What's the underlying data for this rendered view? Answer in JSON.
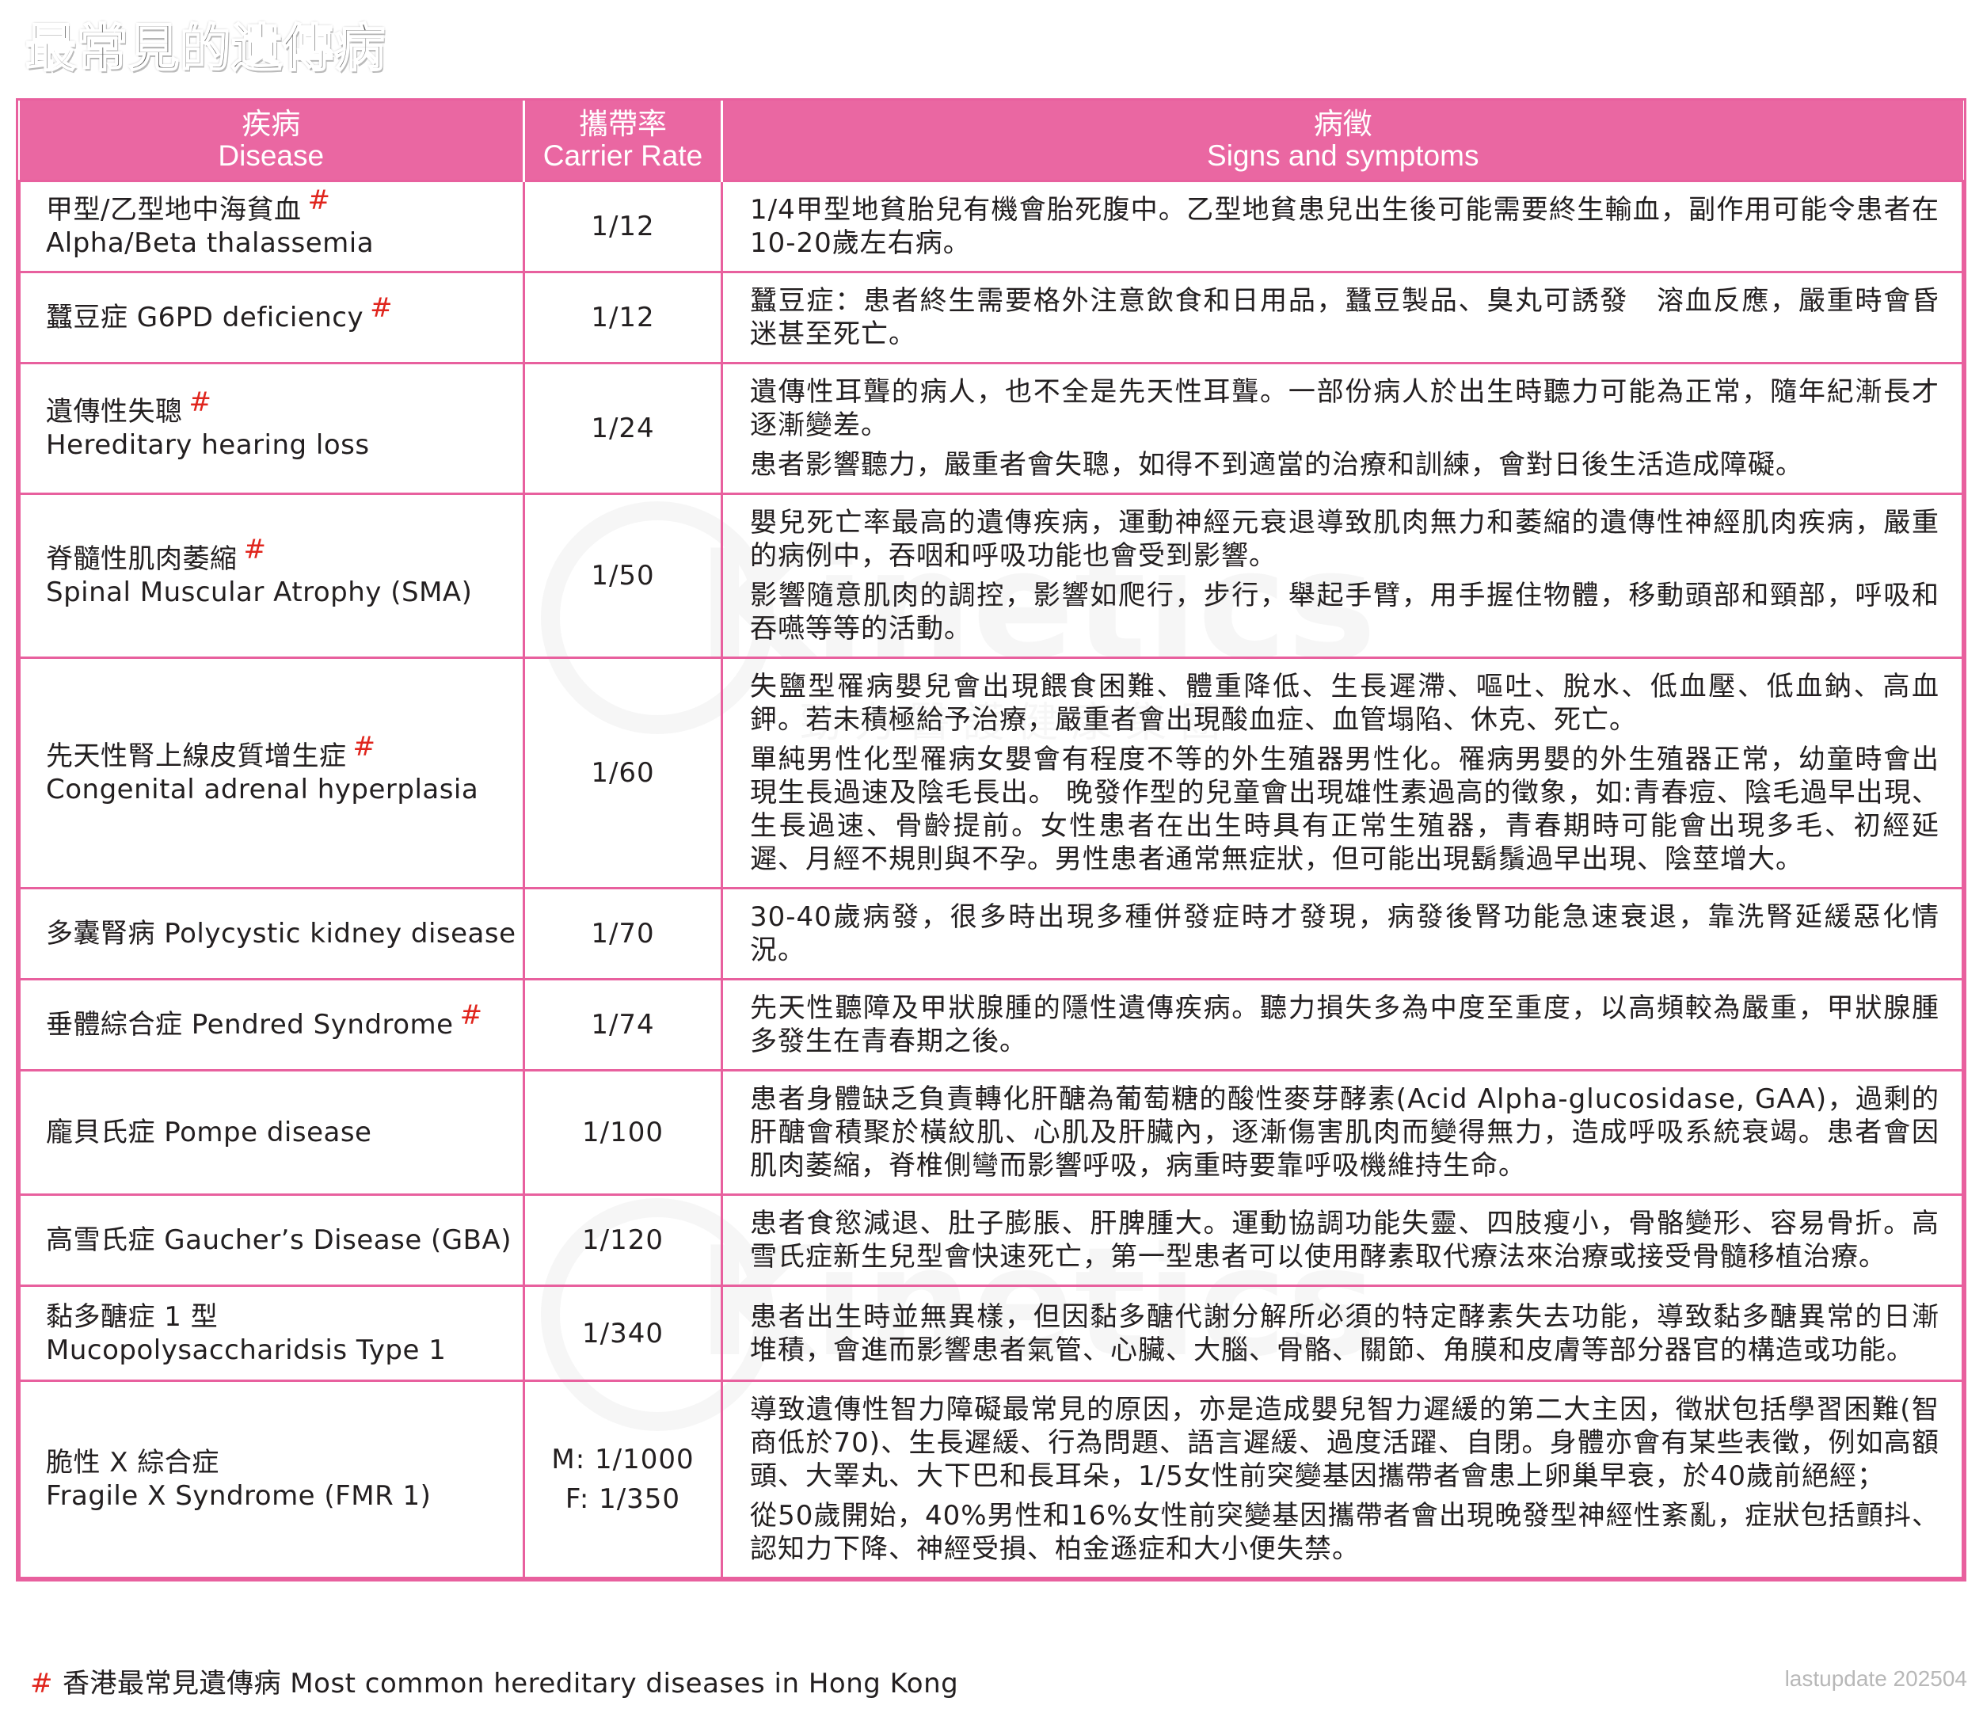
{
  "title": "最常見的遺傳病",
  "watermark": {
    "text": "Kinetics",
    "registered": "®",
    "subtext": "勁 力 醫 護 健 康 集 團",
    "color": "#c9c9c9"
  },
  "colors": {
    "header_bg": "#ea67a2",
    "border": "#e8609e",
    "hash": "#e0251d"
  },
  "header": {
    "disease_zh": "疾病",
    "disease_en": "Disease",
    "rate_zh": "攜帶率",
    "rate_en": "Carrier Rate",
    "symptoms_zh": "病徵",
    "symptoms_en": "Signs and symptoms"
  },
  "rows": [
    {
      "name_line1": "甲型/乙型地中海貧血",
      "name_line2": "Alpha/Beta thalassemia",
      "hk_mark": "#",
      "rate_line1": "1/12",
      "rate_line2": "",
      "symptoms": [
        "1/4甲型地貧胎兒有機會胎死腹中。乙型地貧患兒出生後可能需要終生輸血，副作用可能令患者在10-20歲左右病。"
      ]
    },
    {
      "name_line1": "蠶豆症 G6PD deficiency",
      "name_line2": "",
      "hk_mark": "#",
      "rate_line1": "1/12",
      "rate_line2": "",
      "symptoms": [
        "蠶豆症：患者終生需要格外注意飲食和日用品，蠶豆製品、臭丸可誘發　溶血反應，嚴重時會昏迷甚至死亡。"
      ]
    },
    {
      "name_line1": "遺傳性失聰",
      "name_line2": "Hereditary hearing loss",
      "hk_mark": "#",
      "rate_line1": "1/24",
      "rate_line2": "",
      "symptoms": [
        "遺傳性耳聾的病人，也不全是先天性耳聾。一部份病人於出生時聽力可能為正常，隨年紀漸長才逐漸變差。",
        "患者影響聽力，嚴重者會失聰，如得不到適當的治療和訓練，會對日後生活造成障礙。"
      ]
    },
    {
      "name_line1": "脊髓性肌肉萎縮",
      "name_line2": "Spinal Muscular Atrophy (SMA)",
      "hk_mark": "#",
      "rate_line1": "1/50",
      "rate_line2": "",
      "symptoms": [
        "嬰兒死亡率最高的遺傳疾病，運動神經元衰退導致肌肉無力和萎縮的遺傳性神經肌肉疾病，嚴重的病例中，吞咽和呼吸功能也會受到影響。",
        "影響隨意肌肉的調控，影響如爬行，步行，舉起手臂，用手握住物體，移動頭部和頸部，呼吸和吞嚥等等的活動。"
      ]
    },
    {
      "name_line1": "先天性腎上線皮質增生症",
      "name_line2": "Congenital adrenal hyperplasia",
      "hk_mark": "#",
      "rate_line1": "1/60",
      "rate_line2": "",
      "symptoms": [
        "失鹽型罹病嬰兒會出現餵食困難、體重降低、生長遲滯、嘔吐、脫水、低血壓、低血鈉、高血鉀。若未積極給予治療，嚴重者會出現酸血症、血管塌陷、休克、死亡。",
        "單純男性化型罹病女嬰會有程度不等的外生殖器男性化。罹病男嬰的外生殖器正常，幼童時會出現生長過速及陰毛長出。 晚發作型的兒童會出現雄性素過高的徵象，如:青春痘、陰毛過早出現、生長過速、骨齡提前。女性患者在出生時具有正常生殖器，青春期時可能會出現多毛、初經延遲、月經不規則與不孕。男性患者通常無症狀，但可能出現鬍鬚過早出現、陰莖增大。"
      ]
    },
    {
      "name_line1": "多囊腎病 Polycystic kidney disease",
      "name_line2": "",
      "hk_mark": "",
      "rate_line1": "1/70",
      "rate_line2": "",
      "symptoms": [
        "30-40歲病發，很多時出現多種併發症時才發現，病發後腎功能急速衰退，靠洗腎延緩惡化情況。"
      ]
    },
    {
      "name_line1": "垂體綜合症 Pendred Syndrome",
      "name_line2": "",
      "hk_mark": "#",
      "rate_line1": "1/74",
      "rate_line2": "",
      "symptoms": [
        "先天性聽障及甲狀腺腫的隱性遺傳疾病。聽力損失多為中度至重度，以高頻較為嚴重，甲狀腺腫多發生在青春期之後。"
      ]
    },
    {
      "name_line1": "龐貝氏症 Pompe disease",
      "name_line2": "",
      "hk_mark": "",
      "rate_line1": "1/100",
      "rate_line2": "",
      "symptoms": [
        "患者身體缺乏負責轉化肝醣為葡萄糖的酸性麥芽酵素(Acid Alpha-glucosidase, GAA)，過剩的肝醣會積聚於橫紋肌、心肌及肝臟內，逐漸傷害肌肉而變得無力，造成呼吸系統衰竭。患者會因肌肉萎縮，脊椎側彎而影響呼吸，病重時要靠呼吸機維持生命。"
      ]
    },
    {
      "name_line1": "高雪氏症 Gaucher’s Disease (GBA)",
      "name_line2": "",
      "hk_mark": "",
      "rate_line1": "1/120",
      "rate_line2": "",
      "symptoms": [
        "患者食慾減退、肚子膨脹、肝脾腫大。運動協調功能失靈、四肢瘦小，骨骼變形、容易骨折。高雪氏症新生兒型會快速死亡，第一型患者可以使用酵素取代療法來治療或接受骨髓移植治療。"
      ]
    },
    {
      "name_line1": "黏多醣症 1 型",
      "name_line2": "Mucopolysaccharidsis Type 1",
      "hk_mark": "",
      "rate_line1": "1/340",
      "rate_line2": "",
      "symptoms": [
        "患者出生時並無異樣，但因黏多醣代謝分解所必須的特定酵素失去功能，導致黏多醣異常的日漸堆積，會進而影響患者氣管、心臟、大腦、骨骼、關節、角膜和皮膚等部分器官的構造或功能。"
      ]
    },
    {
      "name_line1": "脆性 X 綜合症",
      "name_line2": "Fragile X Syndrome (FMR 1)",
      "hk_mark": "",
      "rate_line1": "M: 1/1000",
      "rate_line2": "F: 1/350",
      "symptoms": [
        "導致遺傳性智力障礙最常見的原因，亦是造成嬰兒智力遲緩的第二大主因，徵狀包括學習困難(智商低於70)、生長遲緩、行為問題、語言遲緩、過度活躍、自閉。身體亦會有某些表徵，例如高額頭、大睪丸、大下巴和長耳朵，1/5女性前突變基因攜帶者會患上卵巢早衰，於40歲前絕經；",
        "從50歲開始，40%男性和16%女性前突變基因攜帶者會出現晚發型神經性紊亂，症狀包括顫抖、認知力下降、神經受損、柏金遜症和大小便失禁。"
      ]
    }
  ],
  "footer": {
    "hash": "#",
    "note": "香港最常見遺傳病 Most common hereditary diseases in Hong Kong",
    "last_update": "lastupdate 202504"
  }
}
